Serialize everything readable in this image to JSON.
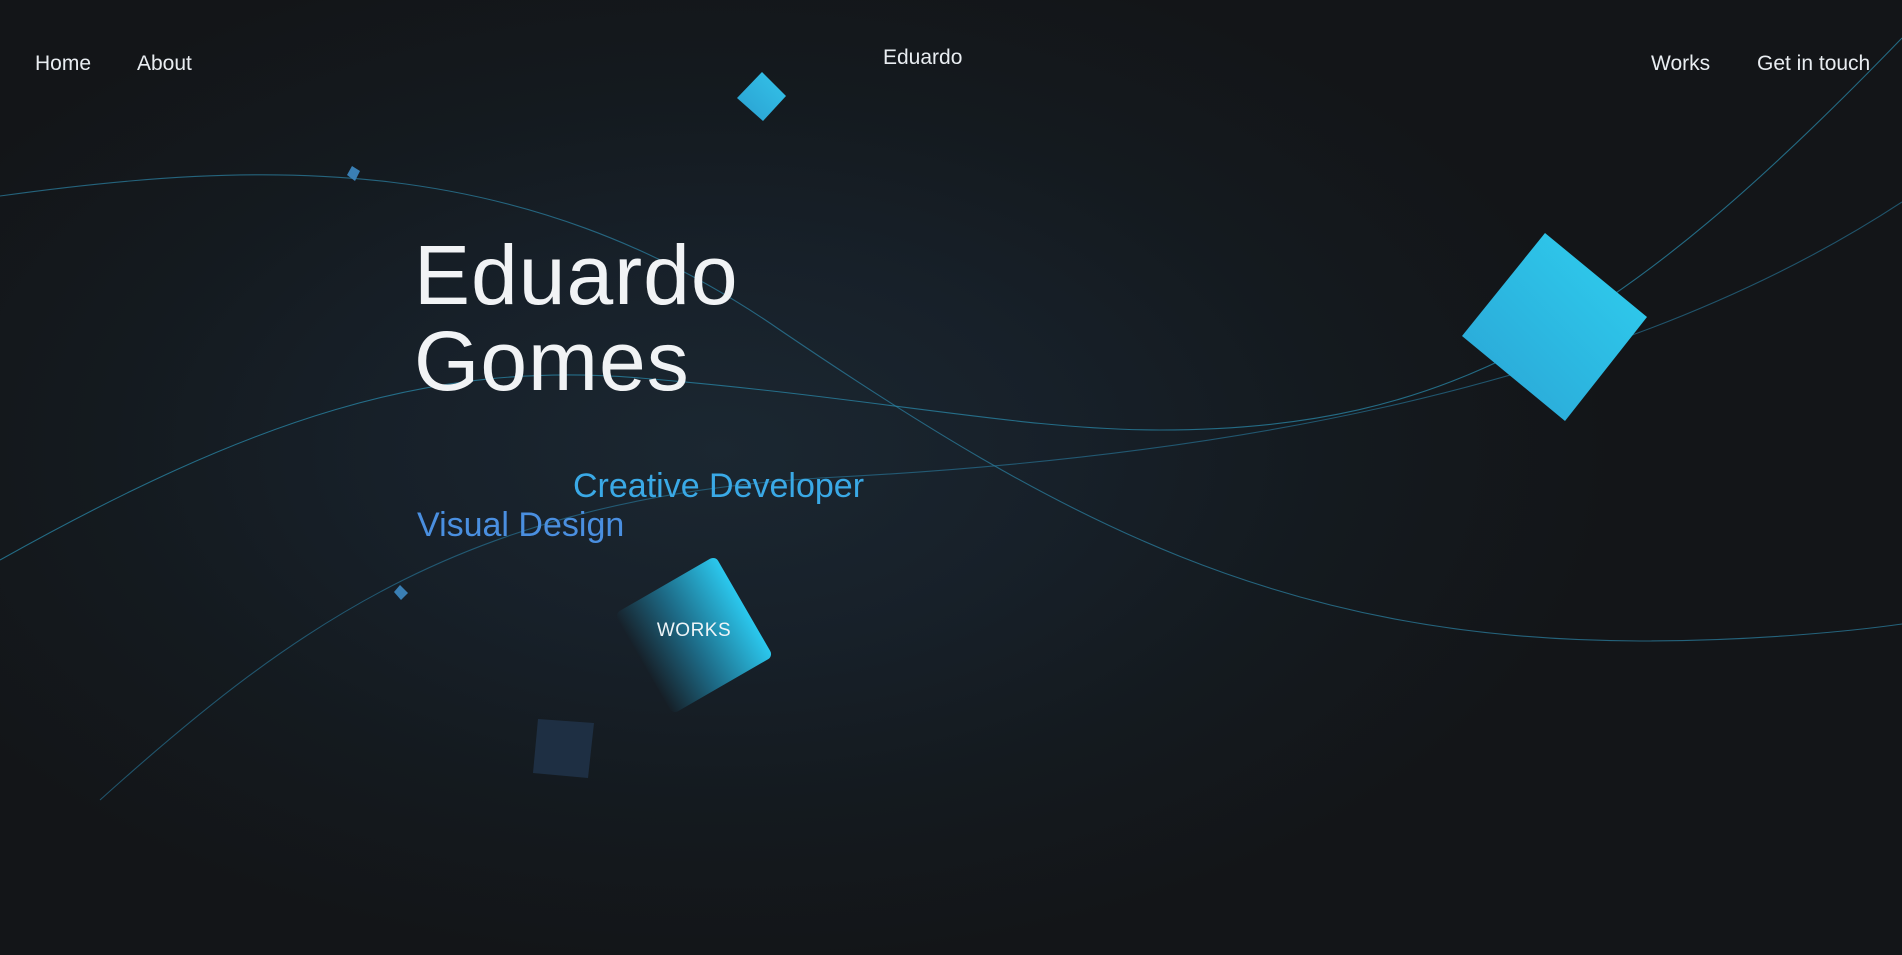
{
  "nav": {
    "home_label": "Home",
    "about_label": "About",
    "brand_label": "Eduardo",
    "works_label": "Works",
    "contact_label": "Get in touch"
  },
  "hero": {
    "name_first": "Eduardo",
    "name_last": "Gomes",
    "role_primary": "Creative Developer",
    "role_secondary": "Visual Design",
    "works_button_label": "WORKS"
  },
  "colors": {
    "background": "#141619",
    "accent": "#2bc8ee",
    "role_primary": "#3aa9e6",
    "role_secondary": "#4a8fe0",
    "text": "#e9edf1"
  }
}
